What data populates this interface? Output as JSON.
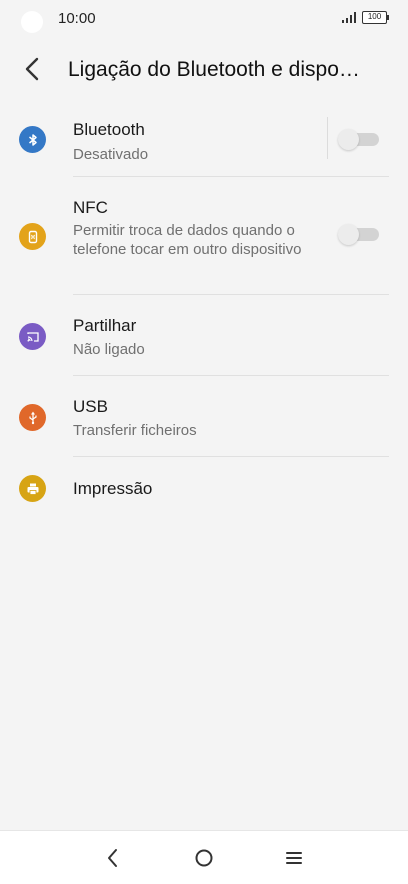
{
  "status_bar": {
    "time": "10:00",
    "battery": "100",
    "icons": [
      "camera-cutout",
      "signal-icon",
      "battery-icon"
    ]
  },
  "header": {
    "title": "Ligação do Bluetooth e dispo…",
    "back_icon": "back-arrow-icon"
  },
  "items": [
    {
      "label": "Bluetooth",
      "sub": "Desativado",
      "icon": "bluetooth-icon",
      "color": "#3478c6",
      "toggle": false
    },
    {
      "label": "NFC",
      "sub": "Permitir troca de dados quando o telefone tocar em outro dispositivo",
      "icon": "nfc-icon",
      "color": "#e3a31a",
      "toggle": false
    },
    {
      "label": "Partilhar",
      "sub": "Não ligado",
      "icon": "cast-icon",
      "color": "#7a5bc4"
    },
    {
      "label": "USB",
      "sub": "Transferir ficheiros",
      "icon": "usb-icon",
      "color": "#e0682a"
    },
    {
      "label": "Impressão",
      "icon": "printer-icon",
      "color": "#d7a414"
    }
  ],
  "nav_bar": {
    "icons": [
      "nav-back-icon",
      "nav-home-icon",
      "nav-menu-icon"
    ]
  }
}
